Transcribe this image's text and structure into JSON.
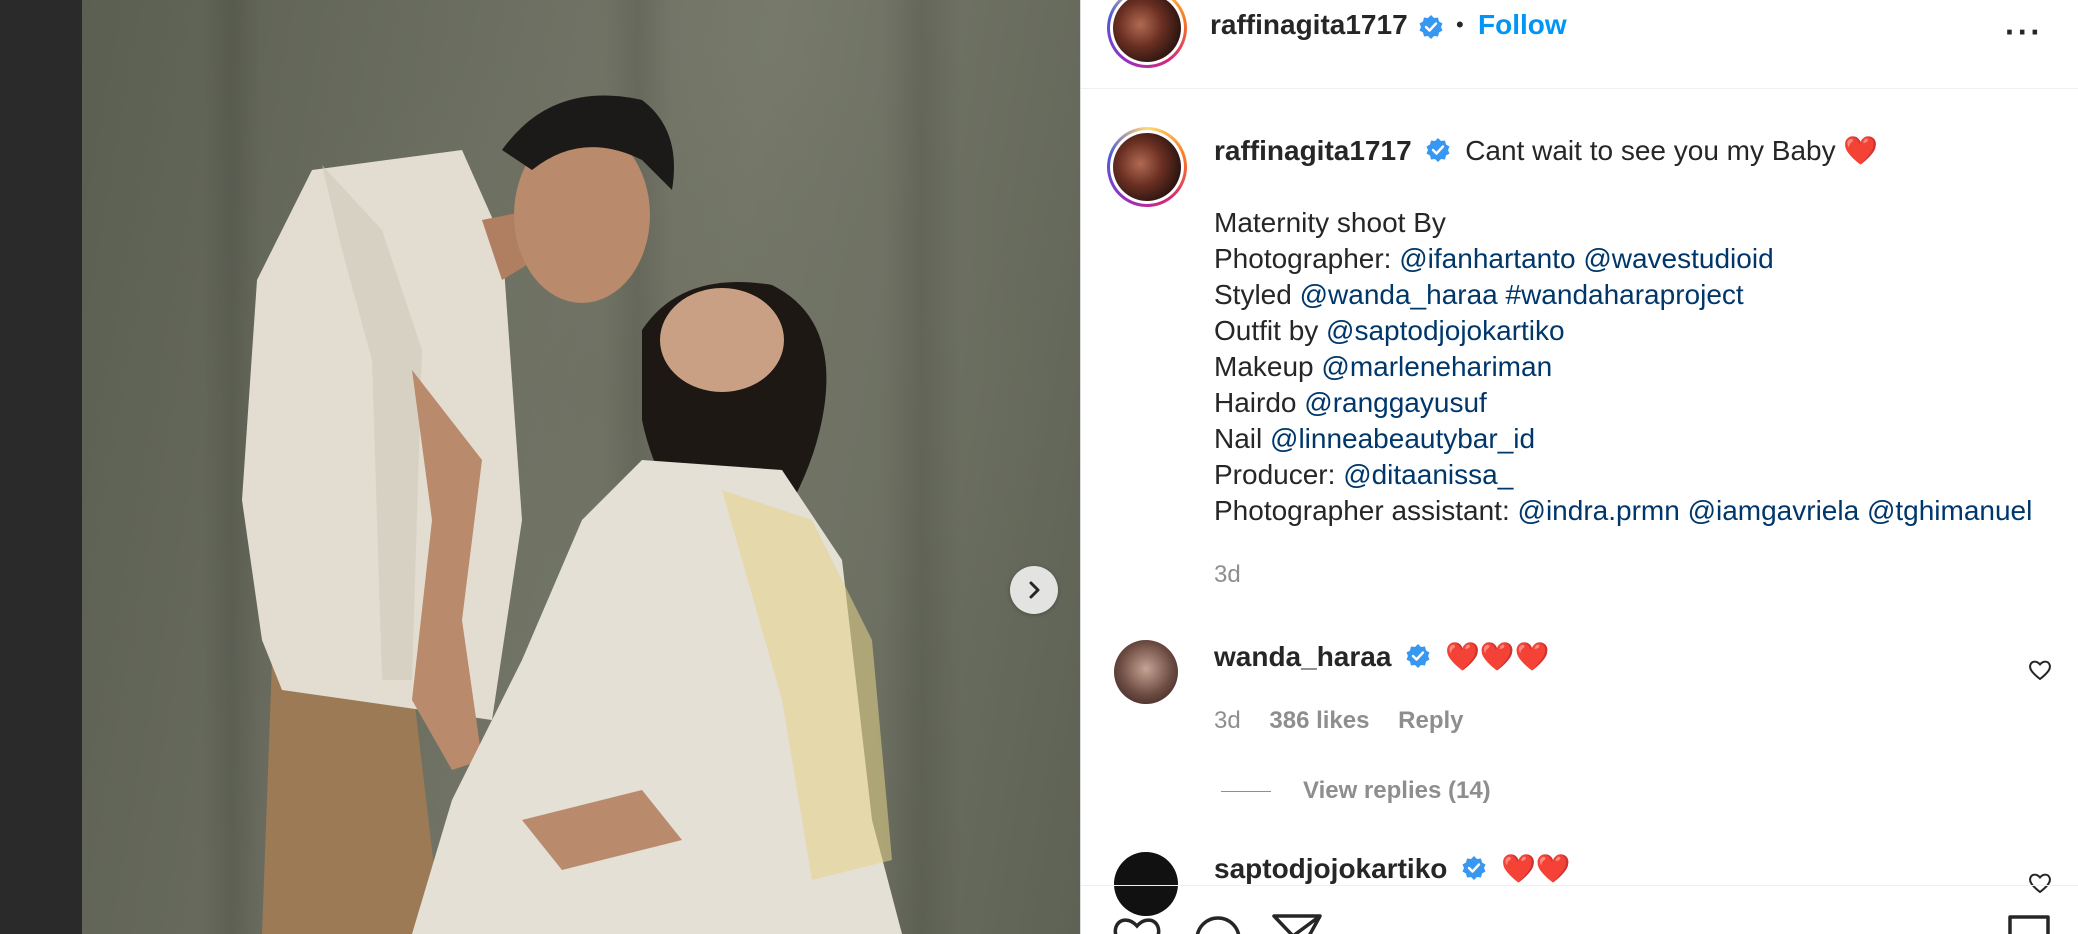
{
  "post": {
    "username": "raffinagita1717",
    "dot": "•",
    "follow_label": "Follow",
    "more_label": "···"
  },
  "caption": {
    "username": "raffinagita1717",
    "line1_text": "Cant wait to see you my Baby",
    "line1_emoji": "❤️",
    "lines": [
      {
        "prefix": "Maternity shoot By",
        "links": ""
      },
      {
        "prefix": "Photographer:",
        "links": "@ifanhartanto @wavestudioid"
      },
      {
        "prefix": "Styled",
        "links": "@wanda_haraa #wandaharaproject"
      },
      {
        "prefix": "Outfit by",
        "links": "@saptodjojokartiko"
      },
      {
        "prefix": "Makeup",
        "links": "@marlenehariman"
      },
      {
        "prefix": "Hairdo",
        "links": "@ranggayusuf"
      },
      {
        "prefix": "Nail",
        "links": "@linneabeautybar_id"
      },
      {
        "prefix": "Producer:",
        "links": "@ditaanissa_"
      },
      {
        "prefix": "Photographer assistant:",
        "links": "@indra.prmn @iamgavriela @tghimanuel"
      }
    ],
    "time": "3d"
  },
  "comments": [
    {
      "username": "wanda_haraa",
      "text": "❤️❤️❤️",
      "time": "3d",
      "likes": "386 likes",
      "reply_label": "Reply",
      "view_replies": "View replies (14)"
    },
    {
      "username": "saptodjojokartiko",
      "text": "❤️❤️"
    }
  ],
  "colors": {
    "link": "#00376b",
    "follow": "#0095f6",
    "verified": "#3897f0",
    "heart": "#ed4956"
  },
  "icons": [
    "verified-badge-icon",
    "chevron-right-icon",
    "more-options-icon",
    "heart-outline-icon",
    "comment-icon",
    "share-icon",
    "save-icon"
  ]
}
